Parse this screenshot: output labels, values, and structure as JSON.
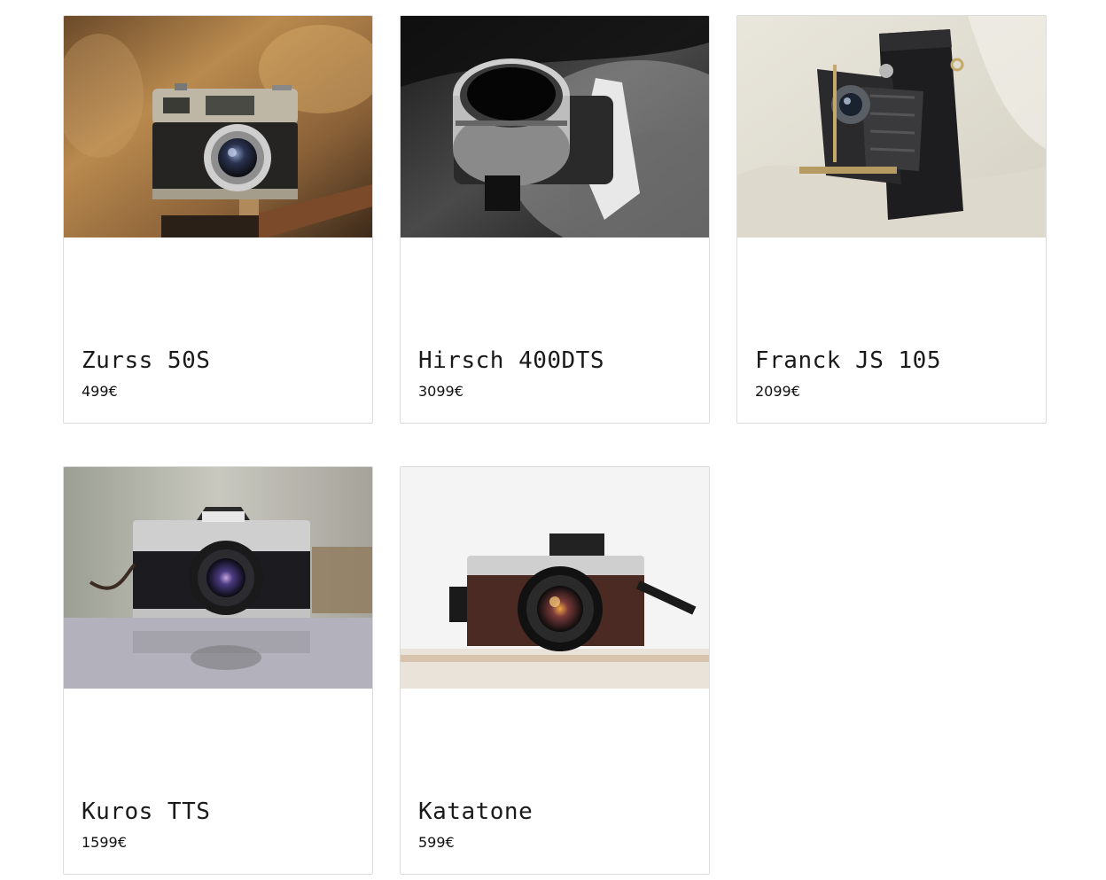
{
  "products": [
    {
      "name": "Zurss 50S",
      "price": "499€",
      "image": "vintage-rangefinder-camera-photo"
    },
    {
      "name": "Hirsch 400DTS",
      "price": "3099€",
      "image": "black-and-white-camera-lens-photo"
    },
    {
      "name": "Franck JS 105",
      "price": "2099€",
      "image": "folding-bellows-camera-photo"
    },
    {
      "name": "Kuros TTS",
      "price": "1599€",
      "image": "slr-camera-photo"
    },
    {
      "name": "Katatone",
      "price": "599€",
      "image": "brown-retro-camera-photo"
    }
  ]
}
